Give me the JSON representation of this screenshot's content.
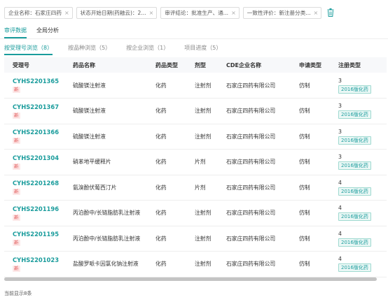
{
  "filters": [
    {
      "label": "企业名称：石家庄四药"
    },
    {
      "label": "状态开始日期(药融云)：2..."
    },
    {
      "label": "审评结论：批准生产、通..."
    },
    {
      "label": "一致性评价：新注册分类..."
    }
  ],
  "main_tabs": [
    {
      "label": "审评数据",
      "active": true
    },
    {
      "label": "全局分析",
      "active": false
    }
  ],
  "sub_tabs": [
    {
      "label": "按受理号浏览（8）",
      "active": true
    },
    {
      "label": "按品种浏览（5）",
      "active": false
    },
    {
      "label": "按企业浏览（1）",
      "active": false
    },
    {
      "label": "项目进度（5）",
      "active": false
    }
  ],
  "table": {
    "headers": [
      "受理号",
      "药品名称",
      "药品类型",
      "剂型",
      "CDE企业名称",
      "申请类型",
      "注册类型"
    ],
    "rows": [
      {
        "accept_no": "CYHS2201365",
        "new_badge": "新",
        "drug": "硫酸镁注射液",
        "drug_type": "化药",
        "form": "注射剂",
        "company": "石家庄四药有限公司",
        "app_type": "仿制",
        "reg_num": "3",
        "reg_tag": "2016版化药"
      },
      {
        "accept_no": "CYHS2201367",
        "new_badge": "新",
        "drug": "硫酸镁注射液",
        "drug_type": "化药",
        "form": "注射剂",
        "company": "石家庄四药有限公司",
        "app_type": "仿制",
        "reg_num": "3",
        "reg_tag": "2016版化药"
      },
      {
        "accept_no": "CYHS2201366",
        "new_badge": "新",
        "drug": "硫酸镁注射液",
        "drug_type": "化药",
        "form": "注射剂",
        "company": "石家庄四药有限公司",
        "app_type": "仿制",
        "reg_num": "3",
        "reg_tag": "2016版化药"
      },
      {
        "accept_no": "CYHS2201304",
        "new_badge": "新",
        "drug": "硝苯地平缓释片",
        "drug_type": "化药",
        "form": "片剂",
        "company": "石家庄四药有限公司",
        "app_type": "仿制",
        "reg_num": "3",
        "reg_tag": "2016版化药"
      },
      {
        "accept_no": "CYHS2201268",
        "new_badge": "新",
        "drug": "氨溴酚伏葡西汀片",
        "drug_type": "化药",
        "form": "片剂",
        "company": "石家庄四药有限公司",
        "app_type": "仿制",
        "reg_num": "4",
        "reg_tag": "2016版化药"
      },
      {
        "accept_no": "CYHS2201196",
        "new_badge": "新",
        "drug": "丙泊酚中/长链脂肪乳注射液",
        "drug_type": "化药",
        "form": "注射剂",
        "company": "石家庄四药有限公司",
        "app_type": "仿制",
        "reg_num": "4",
        "reg_tag": "2016版化药"
      },
      {
        "accept_no": "CYHS2201195",
        "new_badge": "新",
        "drug": "丙泊酚中/长链脂肪乳注射液",
        "drug_type": "化药",
        "form": "注射剂",
        "company": "石家庄四药有限公司",
        "app_type": "仿制",
        "reg_num": "4",
        "reg_tag": "2016版化药"
      },
      {
        "accept_no": "CYHS2201023",
        "new_badge": "新",
        "drug": "盐酸罗哌卡因氯化钠注射液",
        "drug_type": "化药",
        "form": "注射剂",
        "company": "石家庄四药有限公司",
        "app_type": "仿制",
        "reg_num": "4",
        "reg_tag": "2016版化药"
      }
    ]
  },
  "footer": {
    "text": "当前显示8条"
  },
  "colors": {
    "accent": "#1a9c9c",
    "new_badge": "#e05252"
  },
  "icons": {
    "chip_close": "close-icon",
    "clear_filters": "trash-icon"
  }
}
